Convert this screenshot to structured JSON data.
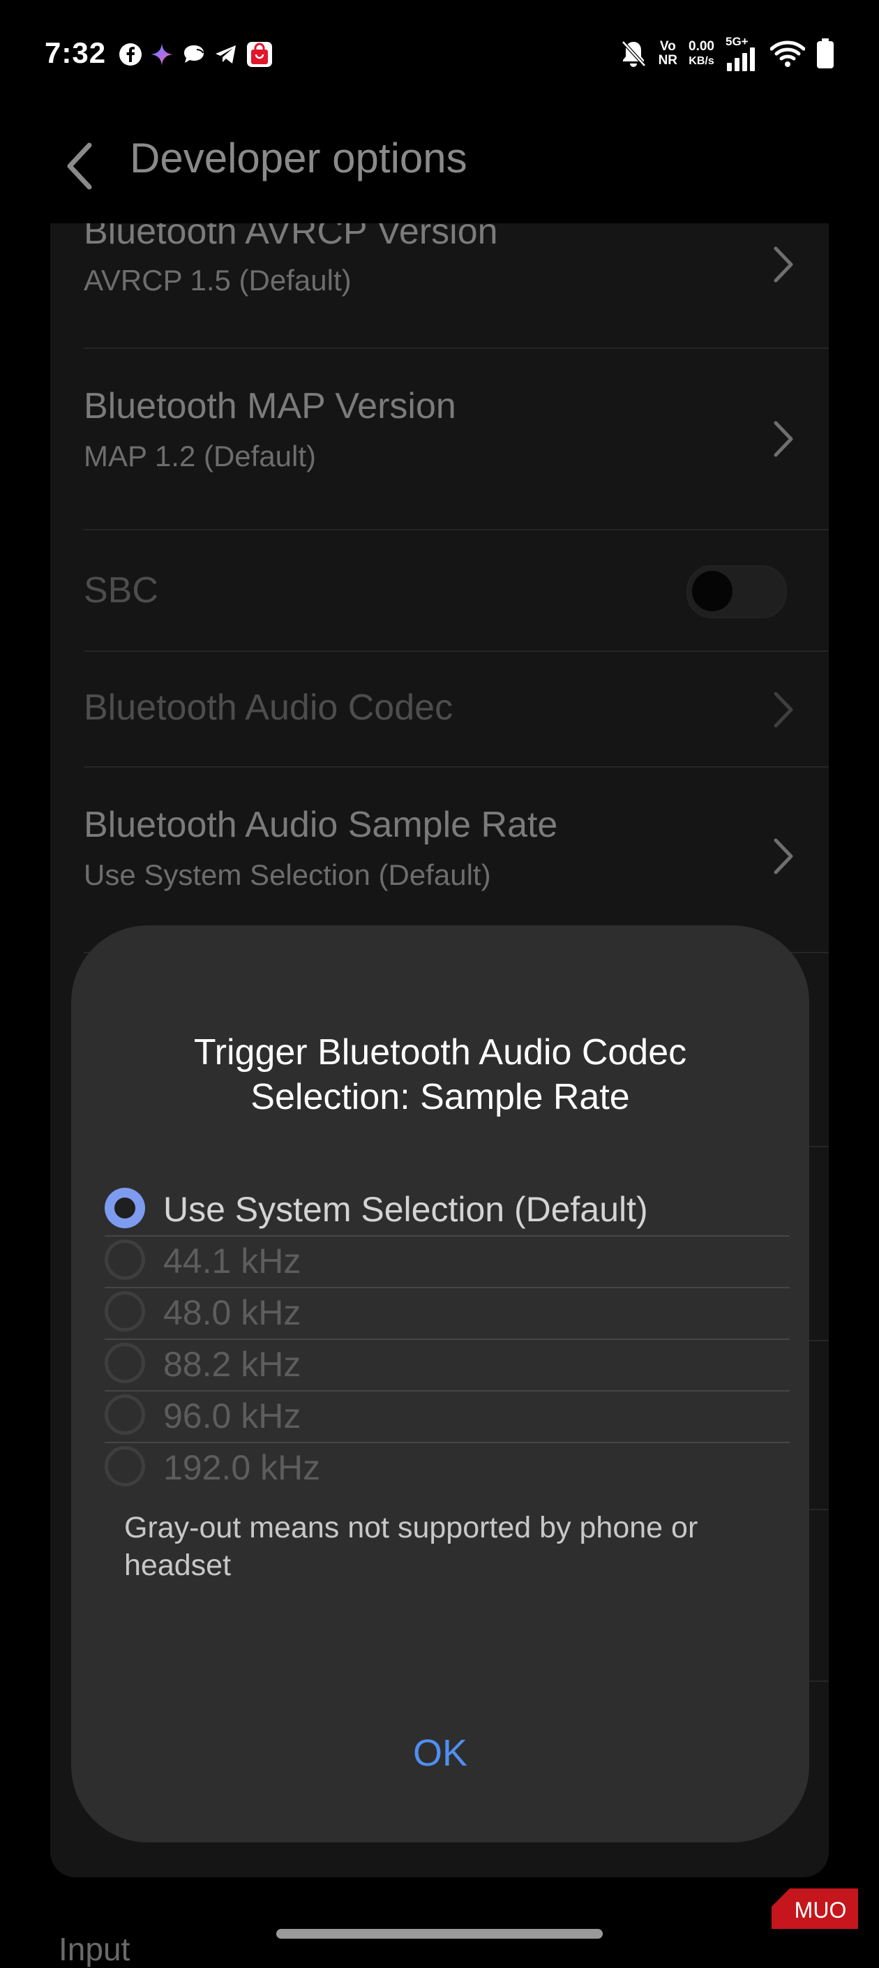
{
  "status_bar": {
    "time": "7:32",
    "notification_icons": [
      "facebook-icon",
      "sparkle-icon",
      "chat-bubble-icon",
      "telegram-icon",
      "shopping-bag-icon"
    ],
    "volte": {
      "top": "Vo",
      "bottom": "NR"
    },
    "net_speed": {
      "value": "0.00",
      "unit": "KB/s"
    },
    "network": "5G+"
  },
  "header": {
    "title": "Developer options"
  },
  "settings": {
    "rows": [
      {
        "title": "Bluetooth AVRCP Version",
        "subtitle": "AVRCP 1.5 (Default)"
      },
      {
        "title": "Bluetooth MAP Version",
        "subtitle": "MAP 1.2 (Default)"
      },
      {
        "title": "SBC",
        "enabled": false,
        "toggle_on": false
      },
      {
        "title": "Bluetooth Audio Codec",
        "enabled": false
      },
      {
        "title": "Bluetooth Audio Sample Rate",
        "subtitle": "Use System Selection (Default)"
      }
    ],
    "next_section_label": "Input"
  },
  "dialog": {
    "title": "Trigger Bluetooth Audio Codec Selection: Sample Rate",
    "options": [
      {
        "label": "Use System Selection (Default)",
        "selected": true,
        "enabled": true
      },
      {
        "label": "44.1 kHz",
        "selected": false,
        "enabled": false
      },
      {
        "label": "48.0 kHz",
        "selected": false,
        "enabled": false
      },
      {
        "label": "88.2 kHz",
        "selected": false,
        "enabled": false
      },
      {
        "label": "96.0 kHz",
        "selected": false,
        "enabled": false
      },
      {
        "label": "192.0 kHz",
        "selected": false,
        "enabled": false
      }
    ],
    "note": "Gray-out means not supported by phone or headset",
    "ok_label": "OK"
  },
  "colors": {
    "accent": "#4f8ff0",
    "radio_selected": "#7d9bef",
    "dialog_bg": "#2e2e2e",
    "watermark": "#c4161c"
  },
  "watermark": {
    "text": "MUO"
  }
}
